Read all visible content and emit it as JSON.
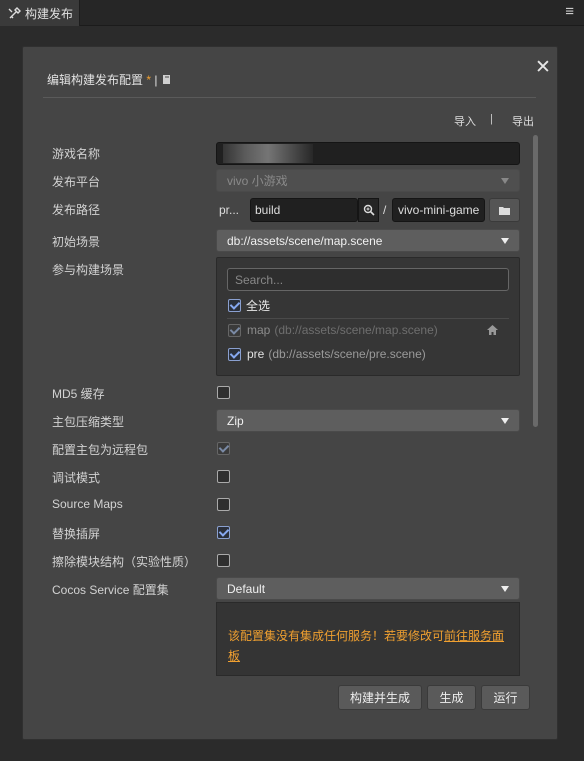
{
  "tab": {
    "title": "构建发布"
  },
  "dialog": {
    "title": "编辑构建发布配置",
    "title_star": "*",
    "title_sep": "|",
    "import_label": "导入",
    "export_label": "导出",
    "io_sep": "|"
  },
  "form": {
    "game_name": {
      "label": "游戏名称",
      "value": ""
    },
    "platform": {
      "label": "发布平台",
      "value": "vivo 小游戏"
    },
    "build_path": {
      "label": "发布路径",
      "prefix": "pr...",
      "dir": "build",
      "sep": "/",
      "name": "vivo-mini-game"
    },
    "start_scene": {
      "label": "初始场景",
      "value": "db://assets/scene/map.scene"
    },
    "included_scenes": {
      "label": "参与构建场景",
      "search_placeholder": "Search...",
      "select_all": "全选",
      "scenes": [
        {
          "name": "map",
          "path": "(db://assets/scene/map.scene)",
          "checked": true,
          "disabled": true
        },
        {
          "name": "pre",
          "path": "(db://assets/scene/pre.scene)",
          "checked": true,
          "disabled": false
        }
      ]
    },
    "md5": {
      "label": "MD5 缓存",
      "checked": false
    },
    "compress_type": {
      "label": "主包压缩类型",
      "value": "Zip"
    },
    "main_remote": {
      "label": "配置主包为远程包",
      "checked": true
    },
    "debug": {
      "label": "调试模式",
      "checked": false
    },
    "source_maps": {
      "label": "Source Maps",
      "checked": false
    },
    "splash": {
      "label": "替换插屏",
      "checked": true
    },
    "erase_modules": {
      "label": "擦除模块结构（实验性质）",
      "checked": false
    },
    "cocos_service": {
      "label": "Cocos Service 配置集",
      "value": "Default"
    },
    "service_warning": {
      "text": "该配置集没有集成任何服务！若要修改可",
      "link": "前往服务面板"
    }
  },
  "buttons": {
    "build_and_make": "构建并生成",
    "make": "生成",
    "run": "运行"
  }
}
